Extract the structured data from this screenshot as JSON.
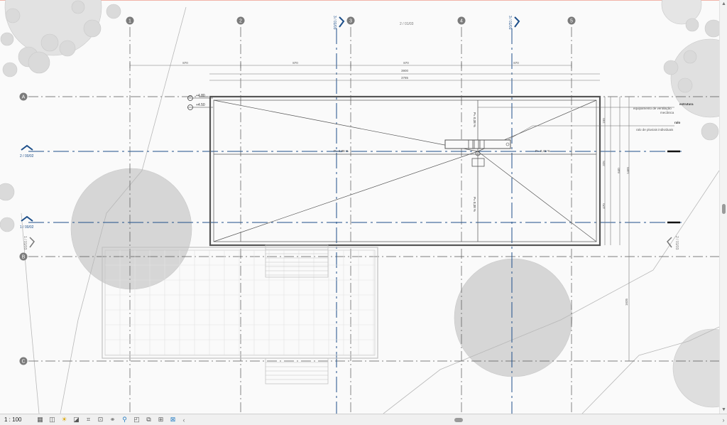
{
  "view": {
    "scale": "1 : 100",
    "grid_columns": [
      "1",
      "2",
      "3",
      "4",
      "5"
    ],
    "grid_rows": [
      "A",
      "B",
      "C"
    ]
  },
  "sections": {
    "top_3": "3 / 01/03",
    "top_4": "3 / 01/03",
    "top_mid": "2 / 01/03",
    "left_a": "2 / 00/02",
    "left_b": "1 / 00/02",
    "left_mid": "1 / 01/03",
    "right_1": "2 / 01/03"
  },
  "elevations": {
    "level_1": "+4.80",
    "level_2": "+4.50"
  },
  "dimensions": {
    "top_outer_1": "870",
    "top_outer_2": "870",
    "top_outer_3": "870",
    "top_outer_4": "870",
    "top_total": "3900",
    "top_inner": "3785",
    "right_1": "640",
    "right_2": "1465",
    "right_3": "1635",
    "right_4": "2520",
    "right_small_1": "150",
    "right_small_2": "325",
    "right_small_3": "470"
  },
  "slopes": {
    "left": "P= 0,86 %",
    "right": "P= 0,43 %",
    "up": "P= 0,38 %",
    "down": "P= 0,38 %"
  },
  "annotations": {
    "equipment_title": "estrutura",
    "equipment_desc_1": "equipamento de ventilação",
    "equipment_desc_2": "mecânica",
    "drain_title": "ralo",
    "drain_desc": "ralo de pluviais individuais"
  },
  "icons": {
    "status": [
      "detail-level-icon",
      "visual-style-icon",
      "sun-path-icon",
      "shadows-icon",
      "crop-view-icon",
      "show-crop-icon",
      "unlock-3d-icon",
      "temporary-hide-icon",
      "reveal-hidden-icon",
      "worksharing-icon",
      "design-options-icon",
      "highlight-icon"
    ]
  },
  "colors": {
    "grid": "#3a3a3a",
    "section": "#1d4f8a",
    "trees": "#d9d9d9",
    "roof": "#555555"
  }
}
